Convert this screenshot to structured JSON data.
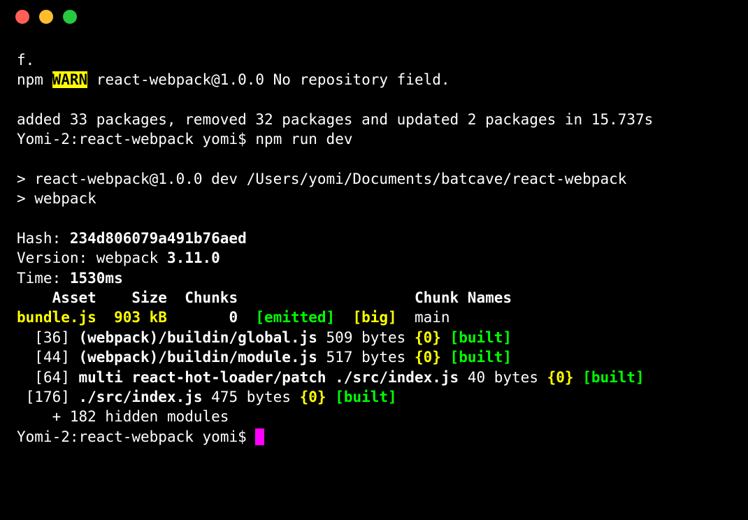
{
  "window": {
    "buttons": [
      "close",
      "minimize",
      "maximize"
    ]
  },
  "terminal": {
    "frag_top": "f.",
    "npm_prefix": "npm ",
    "warn_label": "WARN",
    "warn_rest": " react-webpack@1.0.0 No repository field.",
    "blank": "",
    "added_line": "added 33 packages, removed 32 packages and updated 2 packages in 15.737s",
    "prompt1_host": "Yomi-2:",
    "prompt1_path": "react-webpack",
    "prompt1_user": " yomi$ ",
    "prompt1_cmd": "npm run dev",
    "script_line1": "> react-webpack@1.0.0 dev /Users/yomi/Documents/batcave/react-webpack",
    "script_line2": "> webpack",
    "hash_label": "Hash: ",
    "hash_value": "234d806079a491b76aed",
    "version_label": "Version: webpack ",
    "version_value": "3.11.0",
    "time_label": "Time: ",
    "time_value": "1530ms",
    "table_header": "    Asset    Size  Chunks                    Chunk Names",
    "bundle_asset": "bundle.js",
    "bundle_size": "  903 kB",
    "bundle_chunks": "       0  ",
    "bundle_emitted": "[emitted]",
    "bundle_big": "  [big]",
    "bundle_names": "  main",
    "mod1_id": "  [36] ",
    "mod1_path": "(webpack)/buildin/global.js",
    "mod1_size": " 509 bytes ",
    "mod1_chunk": "{0}",
    "mod1_built": " [built]",
    "mod2_id": "  [44] ",
    "mod2_path": "(webpack)/buildin/module.js",
    "mod2_size": " 517 bytes ",
    "mod2_chunk": "{0}",
    "mod2_built": " [built]",
    "mod3_id": "  [64] ",
    "mod3_path": "multi react-hot-loader/patch ./src/index.js",
    "mod3_size": " 40 bytes ",
    "mod3_chunk": "{0}",
    "mod3_built": " [built]",
    "mod4_id": " [176] ",
    "mod4_path": "./src/index.js",
    "mod4_size": " 475 bytes ",
    "mod4_chunk": "{0}",
    "mod4_built": " [built]",
    "hidden": "    + 182 hidden modules",
    "prompt2_host": "Yomi-2:",
    "prompt2_path": "react-webpack",
    "prompt2_user": " yomi$ "
  }
}
